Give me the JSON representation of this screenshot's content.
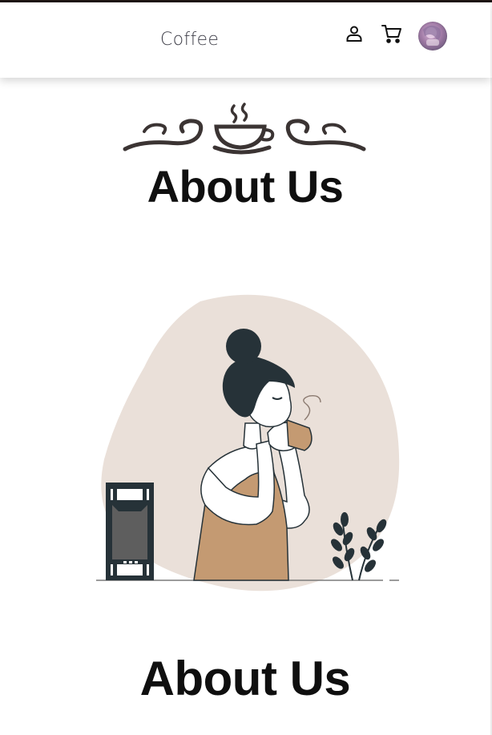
{
  "header": {
    "brand": "Coffee",
    "icons": {
      "account": "user-icon",
      "cart": "cart-icon",
      "avatar": "profile-avatar"
    }
  },
  "hero": {
    "ornament_icon": "coffee-cup-ornament-icon",
    "title": "About Us"
  },
  "illustration": {
    "subject": "woman-drinking-coffee-illustration"
  },
  "section": {
    "title": "About Us"
  },
  "colors": {
    "text": "#0f0f0f",
    "blob": "#eae0d9",
    "apron": "#c49a72",
    "dark": "#263238"
  }
}
